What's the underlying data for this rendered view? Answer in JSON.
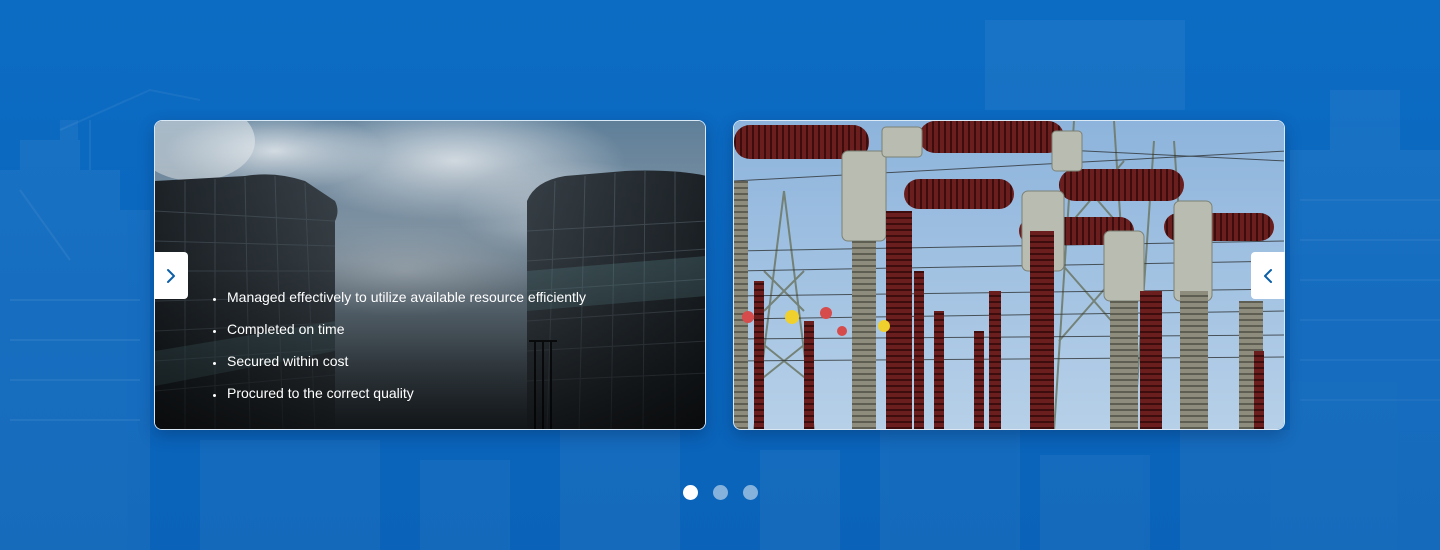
{
  "slider": {
    "cards": [
      {
        "image": "skyscrapers-looking-up",
        "bullets": [
          "Managed effectively to utilize available resource efficiently",
          "Completed on time",
          "Secured within cost",
          "Procured to the correct quality"
        ]
      },
      {
        "image": "electrical-substation-insulators"
      }
    ],
    "next_icon": "chevron-right-icon",
    "prev_icon": "chevron-left-icon",
    "dots": {
      "count": 3,
      "active": 0
    }
  },
  "colors": {
    "background": "#0b6bc2",
    "accent": "#0b5fa8",
    "dot_active": "#ffffff",
    "dot_inactive": "#85b3e0"
  }
}
